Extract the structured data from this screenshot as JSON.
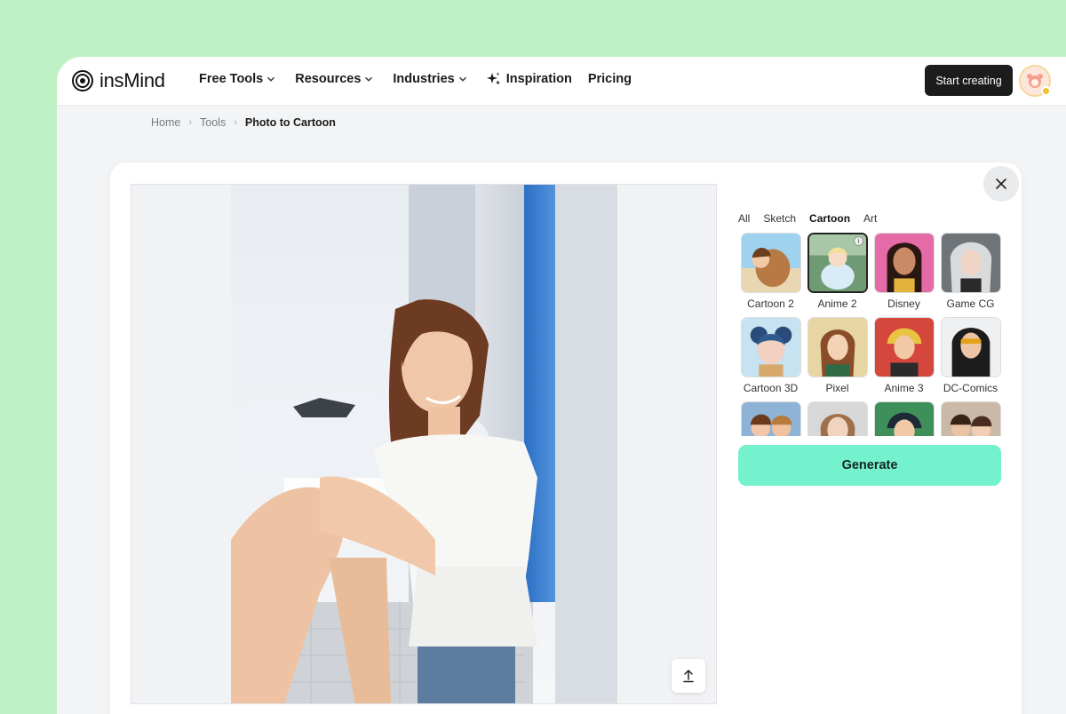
{
  "brand": {
    "name": "insMind"
  },
  "nav": {
    "items": [
      {
        "label": "Free Tools",
        "has_dropdown": true
      },
      {
        "label": "Resources",
        "has_dropdown": true
      },
      {
        "label": "Industries",
        "has_dropdown": true
      },
      {
        "label": "Inspiration",
        "icon": "sparkle-icon"
      },
      {
        "label": "Pricing"
      }
    ],
    "cta_label": "Start creating"
  },
  "breadcrumb": {
    "items": [
      "Home",
      "Tools"
    ],
    "current": "Photo to Cartoon"
  },
  "panel": {
    "tabs": [
      "All",
      "Sketch",
      "Cartoon",
      "Art"
    ],
    "active_tab": "Cartoon",
    "styles": [
      {
        "label": "Cartoon 2"
      },
      {
        "label": "Anime 2",
        "selected": true
      },
      {
        "label": "Disney"
      },
      {
        "label": "Game CG"
      },
      {
        "label": "Cartoon 3D"
      },
      {
        "label": "Pixel"
      },
      {
        "label": "Anime 3"
      },
      {
        "label": "DC-Comics"
      },
      {
        "label": ""
      },
      {
        "label": ""
      },
      {
        "label": ""
      },
      {
        "label": ""
      }
    ],
    "generate_label": "Generate"
  },
  "colors": {
    "background": "#bdf0c3",
    "generate_button": "#74f2cd",
    "cta_button": "#1c1c1c"
  }
}
